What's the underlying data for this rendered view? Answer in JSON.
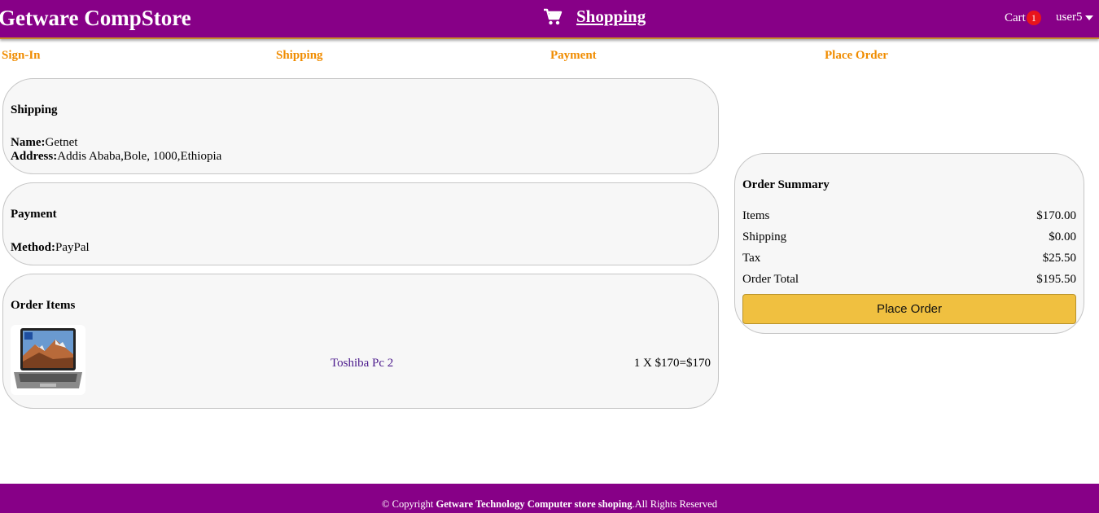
{
  "header": {
    "brand": "Getware CompStore",
    "shopping_label": "Shopping",
    "cart_label": "Cart",
    "cart_count": "1",
    "user_name": "user5",
    "background_color": "#870087"
  },
  "steps": [
    "Sign-In",
    "Shipping",
    "Payment",
    "Place Order"
  ],
  "shipping": {
    "title": "Shipping",
    "name_label": "Name:",
    "name_value": "Getnet",
    "address_label": "Address:",
    "address_value": "Addis Ababa,Bole, 1000,Ethiopia"
  },
  "payment": {
    "title": "Payment",
    "method_label": "Method:",
    "method_value": "PayPal"
  },
  "order_items": {
    "title": "Order Items",
    "items": [
      {
        "name": "Toshiba Pc 2",
        "price_text": "1 X $170=$170"
      }
    ]
  },
  "summary": {
    "title": "Order Summary",
    "rows": [
      {
        "label": "Items",
        "value": "$170.00"
      },
      {
        "label": "Shipping",
        "value": "$0.00"
      },
      {
        "label": "Tax",
        "value": "$25.50"
      },
      {
        "label": "Order Total",
        "value": "$195.50"
      }
    ],
    "button_label": "Place Order",
    "button_color": "#f0c040"
  },
  "footer": {
    "prefix": "© Copyright ",
    "company": "Getware Technology Computer store shoping",
    "suffix": ".All Rights Reserved"
  },
  "colors": {
    "step_accent": "#f08c00",
    "link_purple": "#4b1a8c"
  }
}
